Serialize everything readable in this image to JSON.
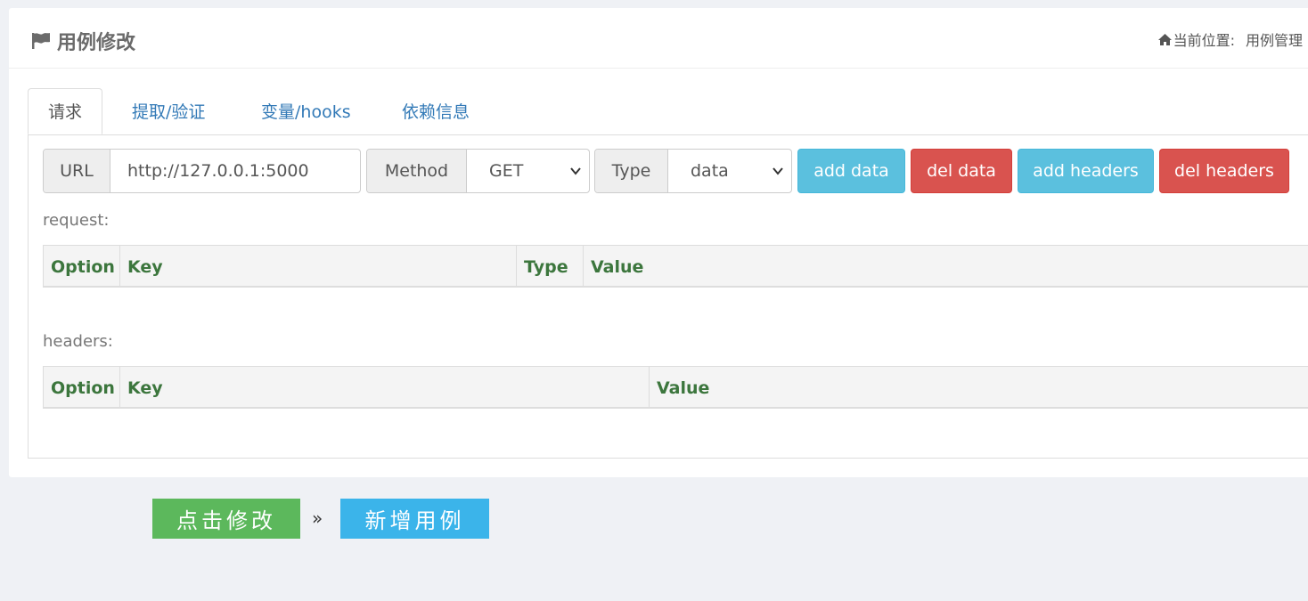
{
  "header": {
    "title": "用例修改",
    "breadcrumb_prefix": "当前位置:",
    "breadcrumb_current": "用例管理"
  },
  "tabs": [
    {
      "label": "请求",
      "active": true
    },
    {
      "label": "提取/验证",
      "active": false
    },
    {
      "label": "变量/hooks",
      "active": false
    },
    {
      "label": "依赖信息",
      "active": false
    }
  ],
  "request_bar": {
    "url_label": "URL",
    "url_value": "http://127.0.0.1:5000",
    "method_label": "Method",
    "method_value": "GET",
    "type_label": "Type",
    "type_value": "data",
    "add_data": "add data",
    "del_data": "del data",
    "add_headers": "add headers",
    "del_headers": "del headers"
  },
  "request_table": {
    "label": "request:",
    "columns": [
      "Option",
      "Key",
      "Type",
      "Value"
    ]
  },
  "headers_table": {
    "label": "headers:",
    "columns": [
      "Option",
      "Key",
      "Value"
    ]
  },
  "footer": {
    "submit": "点击修改",
    "separator": "»",
    "new_case": "新增用例"
  },
  "colors": {
    "info": "#5bc0de",
    "danger": "#d9534f",
    "success": "#5cb85c",
    "primary_light": "#3bb4ea",
    "table_header_text": "#3c763d",
    "link": "#337ab7"
  },
  "icons": {
    "title": "flag-icon",
    "breadcrumb": "home-icon",
    "select": "chevron-down-icon"
  }
}
